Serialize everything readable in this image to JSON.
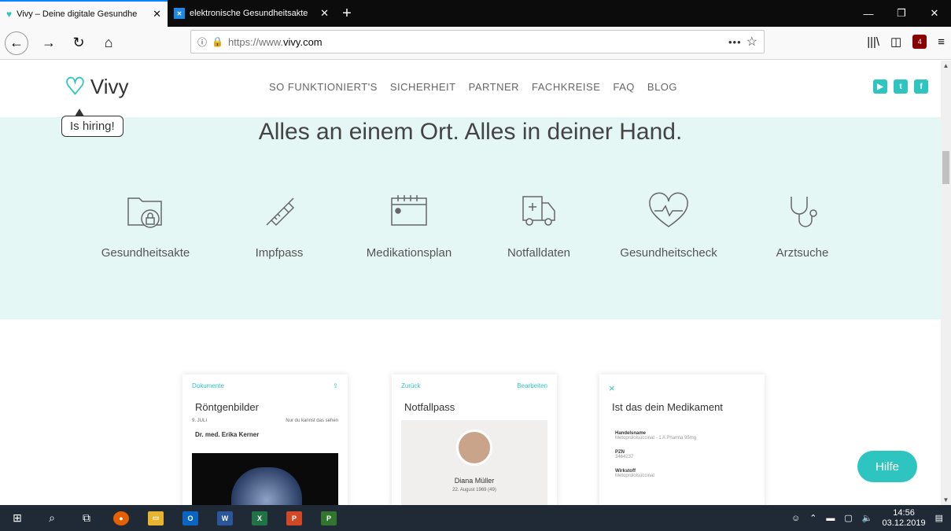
{
  "browser": {
    "tabs": [
      {
        "title": "Vivy – Deine digitale Gesundhe",
        "active": true,
        "icon": "vivy-favicon"
      },
      {
        "title": "elektronische Gesundheitsakte",
        "active": false,
        "icon": "ek-favicon"
      }
    ],
    "url_prefix": "https://www.",
    "url_domain": "vivy.com",
    "url_suffix": "",
    "more_label": "•••"
  },
  "site": {
    "logo_text": "Vivy",
    "hiring_label": "Is hiring!",
    "menu": [
      "SO FUNKTIONIERT'S",
      "SICHERHEIT",
      "PARTNER",
      "FACHKREISE",
      "FAQ",
      "BLOG"
    ],
    "social": [
      "youtube-icon",
      "twitter-icon",
      "facebook-icon"
    ],
    "hero_title": "Alles an einem Ort. Alles in deiner Hand.",
    "features": [
      {
        "label": "Gesundheitsakte",
        "icon": "folder-lock-icon"
      },
      {
        "label": "Impfpass",
        "icon": "syringe-icon"
      },
      {
        "label": "Medikationsplan",
        "icon": "calendar-icon"
      },
      {
        "label": "Notfalldaten",
        "icon": "ambulance-icon"
      },
      {
        "label": "Gesundheitscheck",
        "icon": "heart-pulse-icon"
      },
      {
        "label": "Arztsuche",
        "icon": "stethoscope-icon"
      }
    ],
    "phones": [
      {
        "back": "Dokumente",
        "right": "",
        "title": "Röntgenbilder",
        "date": "9. JULI",
        "note": "Nur du kannst das sehen",
        "doctor": "Dr. med. Erika Kerner"
      },
      {
        "back": "Zurück",
        "right": "Bearbeiten",
        "title": "Notfallpass",
        "name": "Diana Müller",
        "dob": "22. August 1969 (49)"
      },
      {
        "back": "×",
        "right": "",
        "title": "Ist das dein Medikament",
        "f1_label": "Handelsname",
        "f1_value": "Metoprololsuccinat - 1 A Pharma 95mg",
        "f2_label": "PZN",
        "f2_value": "3464237",
        "f3_label": "Wirkstoff",
        "f3_value": "Metoprololsuccinat"
      }
    ],
    "help_label": "Hilfe"
  },
  "taskbar": {
    "time": "14:56",
    "date": "03.12.2019"
  }
}
